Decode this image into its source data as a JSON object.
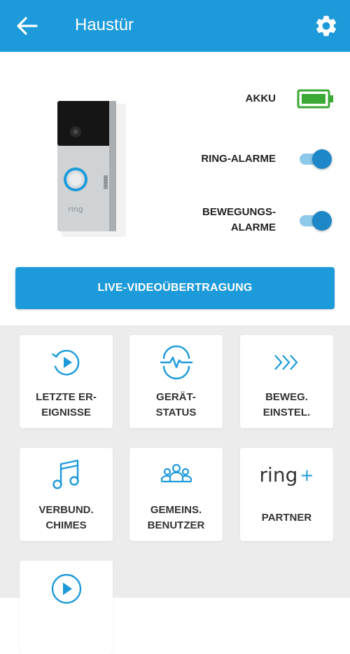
{
  "app_bar": {
    "title": "Haustür",
    "back_icon": "arrow-left-icon",
    "settings_icon": "gear-icon"
  },
  "status": {
    "battery_label": "AKKU",
    "battery_icon": "battery-full-icon",
    "battery_color": "#3aaa35",
    "ring_alarms_label": "RING-ALARME",
    "ring_alarms_on": true,
    "motion_alarms_label": "BEWEGUNGS-\nALARME",
    "motion_alarms_on": true
  },
  "device_image": {
    "brand_text": "ring"
  },
  "live_button": {
    "label": "LIVE-VIDEOÜBERTRAGUNG"
  },
  "tiles": [
    {
      "label": "LETZTE ER-\nEIGNISSE",
      "icon": "history-play-icon"
    },
    {
      "label": "GERÄT-\nSTATUS",
      "icon": "device-health-icon"
    },
    {
      "label": "BEWEG.\nEINSTEL.",
      "icon": "motion-chevrons-icon"
    },
    {
      "label": "VERBUND.\nCHIMES",
      "icon": "music-note-icon"
    },
    {
      "label": "GEMEINS.\nBENUTZER",
      "icon": "users-group-icon"
    },
    {
      "label": "PARTNER",
      "icon": "ring-plus-logo",
      "logo_text": "ring",
      "logo_plus": "+"
    },
    {
      "label": "",
      "icon": "play-circle-icon"
    }
  ],
  "colors": {
    "accent": "#1d9ad9",
    "toggle_knob": "#1d87c7",
    "toggle_track": "#8cc9ea",
    "background_grid": "#ececec"
  }
}
